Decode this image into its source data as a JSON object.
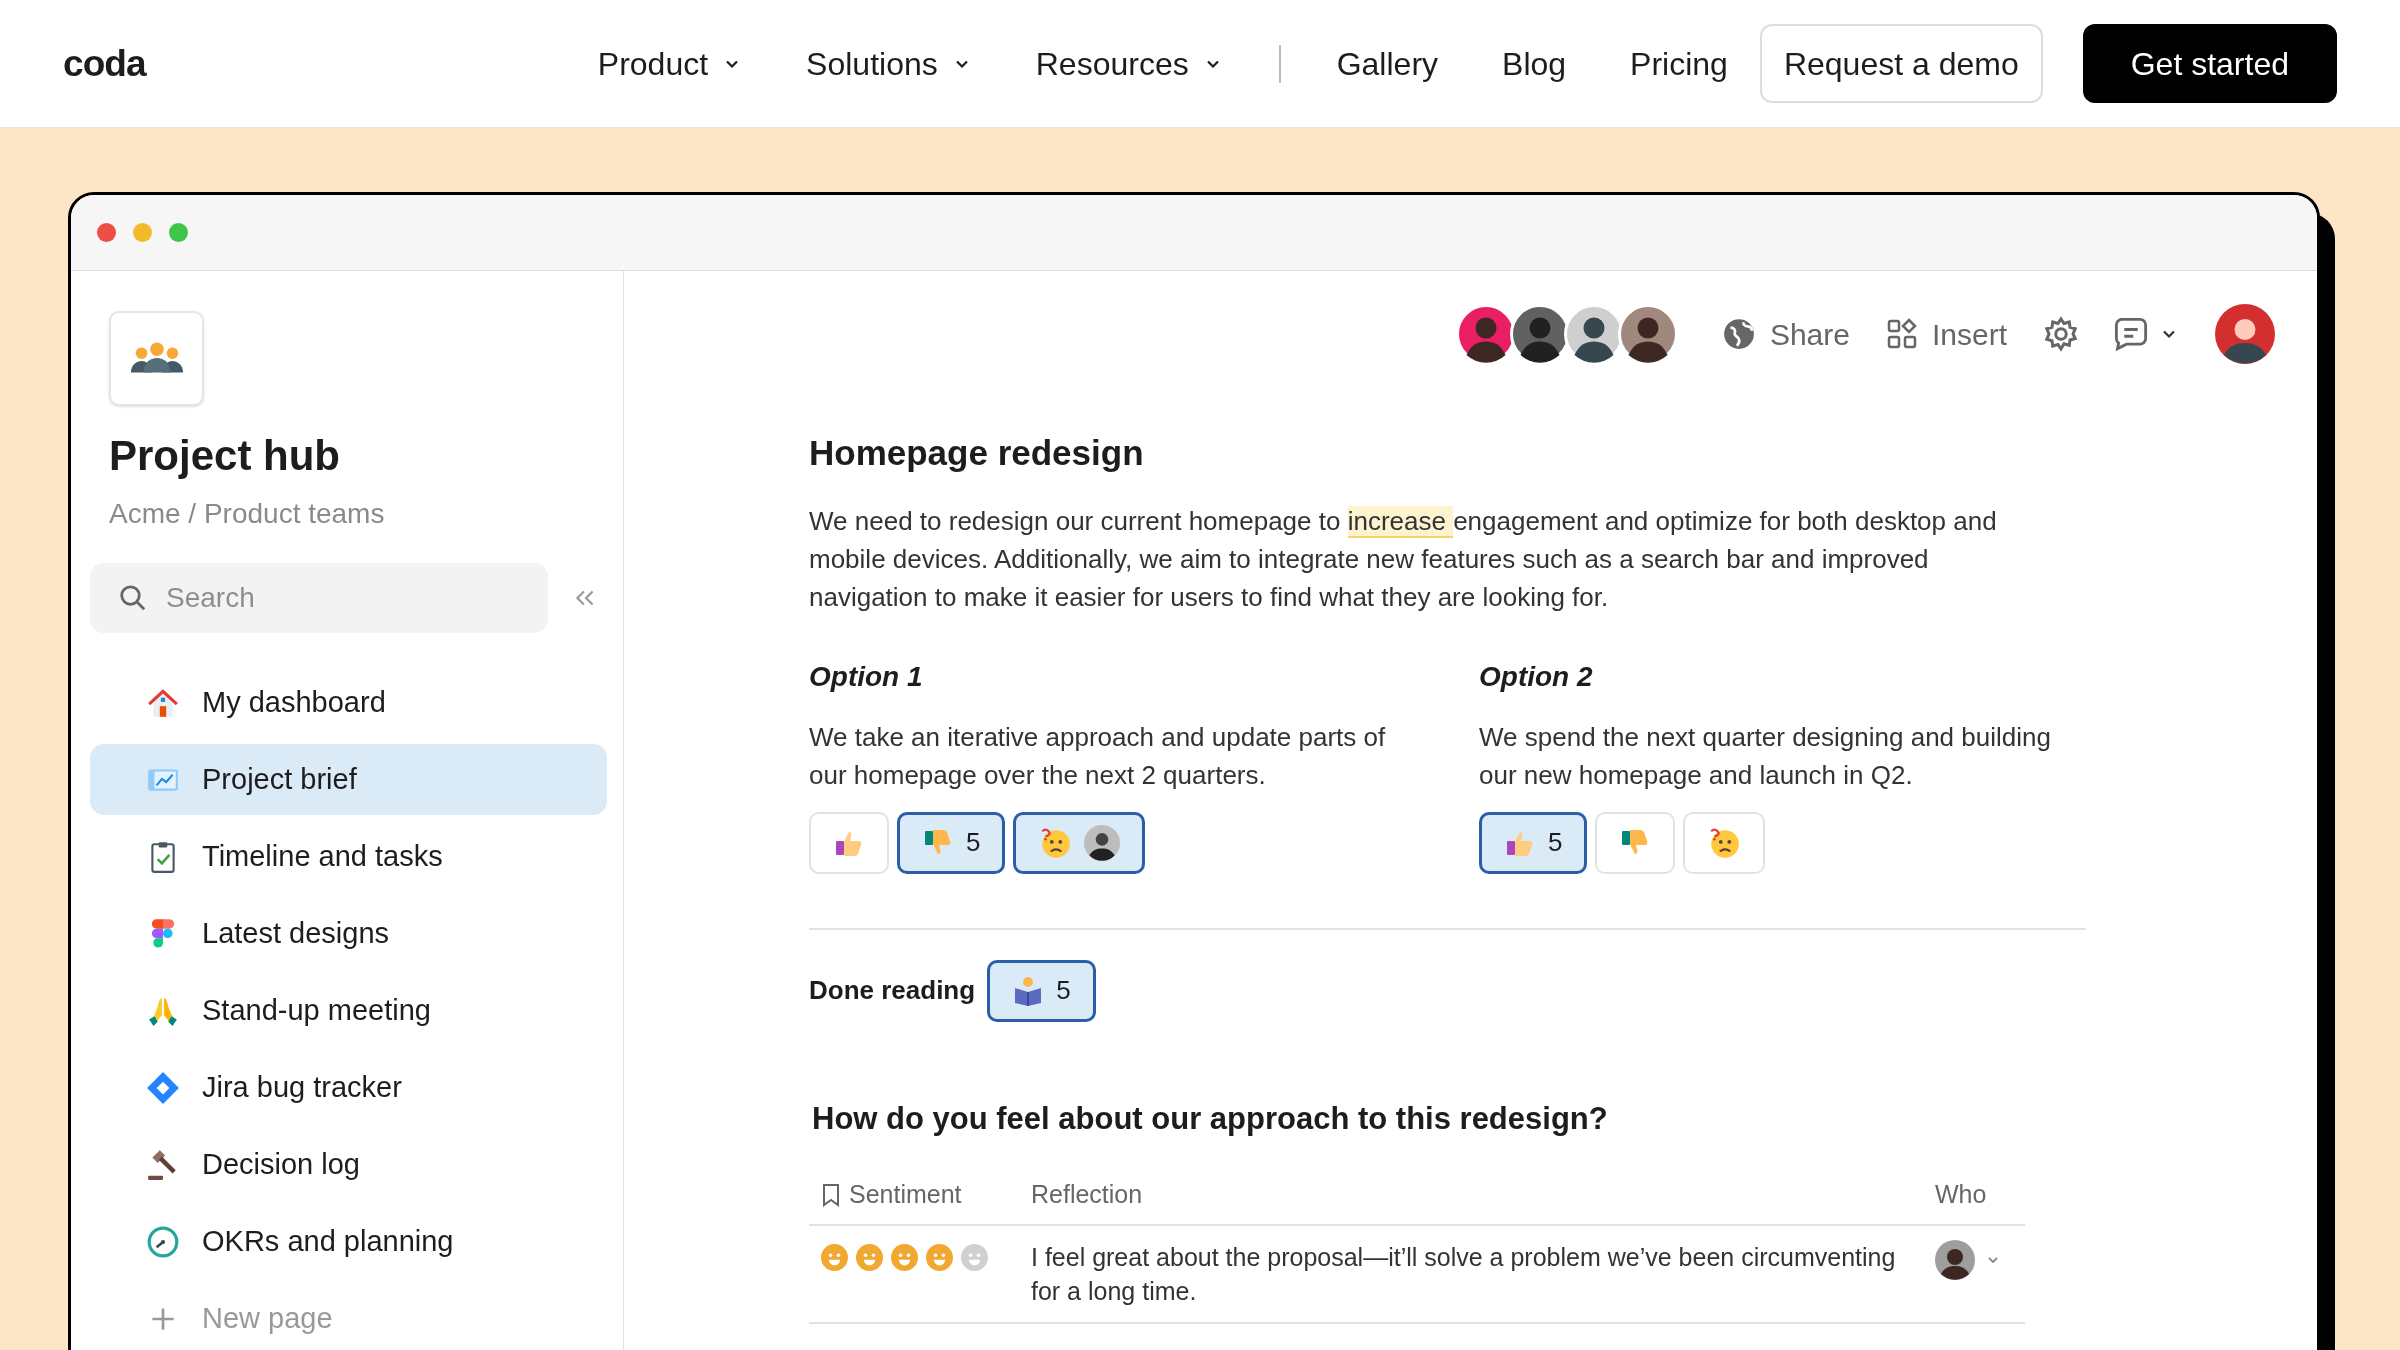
{
  "nav": {
    "logo": "coda",
    "menus": [
      {
        "label": "Product",
        "dropdown": true
      },
      {
        "label": "Solutions",
        "dropdown": true
      },
      {
        "label": "Resources",
        "dropdown": true
      }
    ],
    "links": [
      {
        "label": "Gallery"
      },
      {
        "label": "Blog"
      },
      {
        "label": "Pricing"
      }
    ],
    "buttons": [
      {
        "label": "Request a demo",
        "kind": "outline"
      },
      {
        "label": "Get started",
        "kind": "primary"
      }
    ]
  },
  "sidebar": {
    "title": "Project hub",
    "breadcrumb": "Acme / Product teams",
    "search": {
      "placeholder": "Search"
    },
    "items": [
      {
        "label": "My dashboard",
        "kind": "house",
        "selected": false
      },
      {
        "label": "Project brief",
        "kind": "chart",
        "selected": true
      },
      {
        "label": "Timeline and tasks",
        "kind": "clipboard",
        "selected": false
      },
      {
        "label": "Latest designs",
        "kind": "figma",
        "selected": false
      },
      {
        "label": "Stand-up meeting",
        "kind": "hands",
        "selected": false
      },
      {
        "label": "Jira bug tracker",
        "kind": "diamond",
        "selected": false
      },
      {
        "label": "Decision log",
        "kind": "gavel",
        "selected": false
      },
      {
        "label": "OKRs and planning",
        "kind": "gauge",
        "selected": false
      },
      {
        "label": "New page",
        "kind": "add",
        "selected": false
      }
    ]
  },
  "toolbar": {
    "share": "Share",
    "insert": "Insert"
  },
  "doc": {
    "title": "Homepage redesign",
    "paragraph": [
      {
        "text": "We need to redesign our current homepage to ",
        "highlighted": false
      },
      {
        "text": "increase ",
        "highlighted": true
      },
      {
        "text": "engagement and optimize for both desktop and mobile devices. Additionally, we aim to integrate new features such as a search bar and improved navigation to make it easier for users to find what they are looking for.",
        "highlighted": false
      }
    ],
    "options": [
      {
        "title": "Option 1",
        "text": "We take an iterative approach and update parts of our homepage over the next 2 quarters.",
        "reactions": [
          {
            "kind": "thumbs_up",
            "selected": false
          },
          {
            "kind": "thumbs_down",
            "selected": true,
            "count": "5"
          },
          {
            "kind": "confused",
            "selected": true,
            "avatar": true
          }
        ]
      },
      {
        "title": "Option 2",
        "text": "We spend the next quarter designing and building our new homepage and launch in Q2.",
        "reactions": [
          {
            "kind": "thumbs_up",
            "selected": true,
            "count": "5"
          },
          {
            "kind": "thumbs_down",
            "selected": false
          },
          {
            "kind": "confused",
            "selected": false
          }
        ]
      }
    ],
    "done_reading": {
      "label": "Done reading",
      "reaction": {
        "kind": "reading",
        "selected": true,
        "count": "5"
      }
    },
    "question": "How do you feel about our approach to this redesign?",
    "table": {
      "columns": [
        "Sentiment",
        "Reflection",
        "Who"
      ],
      "rows": [
        {
          "stars": 4,
          "reflection": "I feel great about the proposal—it’ll solve a problem we’ve been circumventing for a long time."
        }
      ]
    }
  }
}
